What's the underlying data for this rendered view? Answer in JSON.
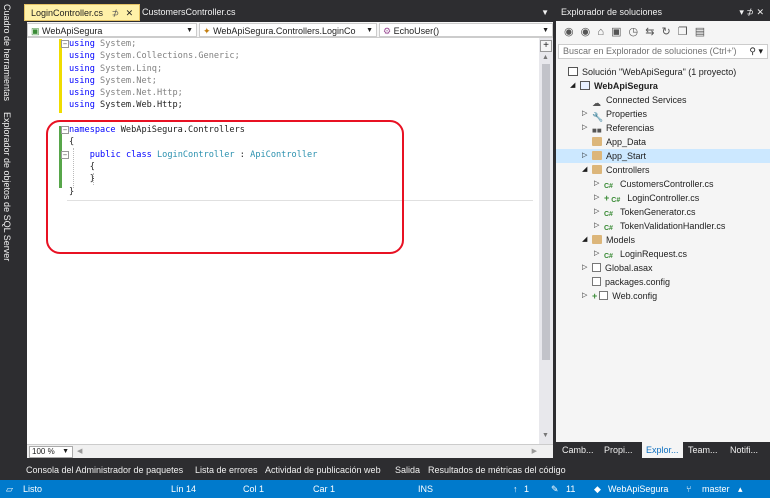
{
  "left_strip": {
    "items": [
      "Cuadro de herramientas",
      "Explorador de objetos de SQL Server"
    ]
  },
  "editor": {
    "tabs": [
      {
        "label": "LoginController.cs",
        "pin": "⊅",
        "close": "✕",
        "active": true
      },
      {
        "label": "CustomersController.cs",
        "active": false
      }
    ],
    "navbar": {
      "project": "WebApiSegura",
      "class": "WebApiSegura.Controllers.LoginCo",
      "member": "EchoUser()"
    },
    "code_lines": [
      {
        "indent": "",
        "parts": [
          {
            "t": "using",
            "c": "kw"
          },
          {
            "t": " System;",
            "c": "gray"
          }
        ]
      },
      {
        "indent": "",
        "parts": [
          {
            "t": "using",
            "c": "kw"
          },
          {
            "t": " System.Collections.Generic;",
            "c": "gray"
          }
        ]
      },
      {
        "indent": "",
        "parts": [
          {
            "t": "using",
            "c": "kw"
          },
          {
            "t": " System.Linq;",
            "c": "gray"
          }
        ]
      },
      {
        "indent": "",
        "parts": [
          {
            "t": "using",
            "c": "kw"
          },
          {
            "t": " System.Net;",
            "c": "gray"
          }
        ]
      },
      {
        "indent": "",
        "parts": [
          {
            "t": "using",
            "c": "kw"
          },
          {
            "t": " System.Net.Http;",
            "c": "gray"
          }
        ]
      },
      {
        "indent": "",
        "parts": [
          {
            "t": "using",
            "c": "kw"
          },
          {
            "t": " System.Web.Http;",
            "c": ""
          }
        ]
      },
      {
        "indent": "",
        "parts": []
      },
      {
        "indent": "",
        "parts": [
          {
            "t": "namespace",
            "c": "kw"
          },
          {
            "t": " WebApiSegura.Controllers",
            "c": ""
          }
        ]
      },
      {
        "indent": "",
        "parts": [
          {
            "t": "{",
            "c": ""
          }
        ]
      },
      {
        "indent": "    ",
        "parts": [
          {
            "t": "public",
            "c": "kw"
          },
          {
            "t": " ",
            "c": ""
          },
          {
            "t": "class",
            "c": "kw"
          },
          {
            "t": " ",
            "c": ""
          },
          {
            "t": "LoginController",
            "c": "typ"
          },
          {
            "t": " : ",
            "c": ""
          },
          {
            "t": "ApiController",
            "c": "typ"
          }
        ]
      },
      {
        "indent": "    ",
        "parts": [
          {
            "t": "{",
            "c": ""
          }
        ]
      },
      {
        "indent": "    ",
        "parts": [
          {
            "t": "}",
            "c": ""
          }
        ]
      },
      {
        "indent": "",
        "parts": [
          {
            "t": "}",
            "c": ""
          }
        ]
      }
    ],
    "zoom": "100 %"
  },
  "solution_explorer": {
    "title": "Explorador de soluciones",
    "title_controls": "▾ ⊅ ✕",
    "toolbar_icons": [
      "back-icon",
      "forward-icon",
      "home-icon",
      "switch-views-icon",
      "history-icon",
      "sync-icon",
      "refresh-icon",
      "copy-icon",
      "preview-icon"
    ],
    "search_placeholder": "Buscar en Explorador de soluciones (Ctrl+')",
    "tree": [
      {
        "label": "Solución \"WebApiSegura\" (1 proyecto)",
        "icon": "solution-icon",
        "level": 0,
        "arrow": ""
      },
      {
        "label": "WebApiSegura",
        "icon": "project-icon",
        "level": 1,
        "arrow": "◢",
        "bold": true
      },
      {
        "label": "Connected Services",
        "icon": "connected-services-icon",
        "level": 2,
        "arrow": ""
      },
      {
        "label": "Properties",
        "icon": "wrench-icon",
        "level": 2,
        "arrow": "▷"
      },
      {
        "label": "Referencias",
        "icon": "references-icon",
        "level": 2,
        "arrow": "▷"
      },
      {
        "label": "App_Data",
        "icon": "folder-icon",
        "level": 2,
        "arrow": ""
      },
      {
        "label": "App_Start",
        "icon": "folder-icon",
        "level": 2,
        "arrow": "▷",
        "selected": true
      },
      {
        "label": "Controllers",
        "icon": "folder-icon",
        "level": 2,
        "arrow": "◢"
      },
      {
        "label": "CustomersController.cs",
        "icon": "csharp-icon",
        "level": 3,
        "arrow": "▷"
      },
      {
        "label": "LoginController.cs",
        "icon": "csharp-icon",
        "level": 3,
        "arrow": "▷",
        "plus": true
      },
      {
        "label": "TokenGenerator.cs",
        "icon": "csharp-icon",
        "level": 3,
        "arrow": "▷"
      },
      {
        "label": "TokenValidationHandler.cs",
        "icon": "csharp-icon",
        "level": 3,
        "arrow": "▷"
      },
      {
        "label": "Models",
        "icon": "folder-icon",
        "level": 2,
        "arrow": "◢"
      },
      {
        "label": "LoginRequest.cs",
        "icon": "csharp-icon",
        "level": 3,
        "arrow": "▷"
      },
      {
        "label": "Global.asax",
        "icon": "global-asax-icon",
        "level": 2,
        "arrow": "▷"
      },
      {
        "label": "packages.config",
        "icon": "config-icon",
        "level": 2,
        "arrow": ""
      },
      {
        "label": "Web.config",
        "icon": "config-icon",
        "level": 2,
        "arrow": "▷",
        "plus": true
      }
    ],
    "bottom_tabs": [
      "Camb...",
      "Propi...",
      "Explor...",
      "Team...",
      "Notifi..."
    ]
  },
  "bottom_panels": [
    "Consola del Administrador de paquetes",
    "Lista de errores",
    "Actividad de publicación web",
    "Salida",
    "Resultados de métricas del código"
  ],
  "status_bar": {
    "state": "Listo",
    "line": "Lín 14",
    "col": "Col 1",
    "car": "Car 1",
    "mode": "INS",
    "up_count": "1",
    "pencil_count": "11",
    "repo": "WebApiSegura",
    "branch": "master"
  },
  "colors": {
    "accent": "#007acc",
    "active_tab": "#fff1a8",
    "highlight_box": "#e81123",
    "keyword": "#0000ff",
    "type": "#2b91af"
  }
}
